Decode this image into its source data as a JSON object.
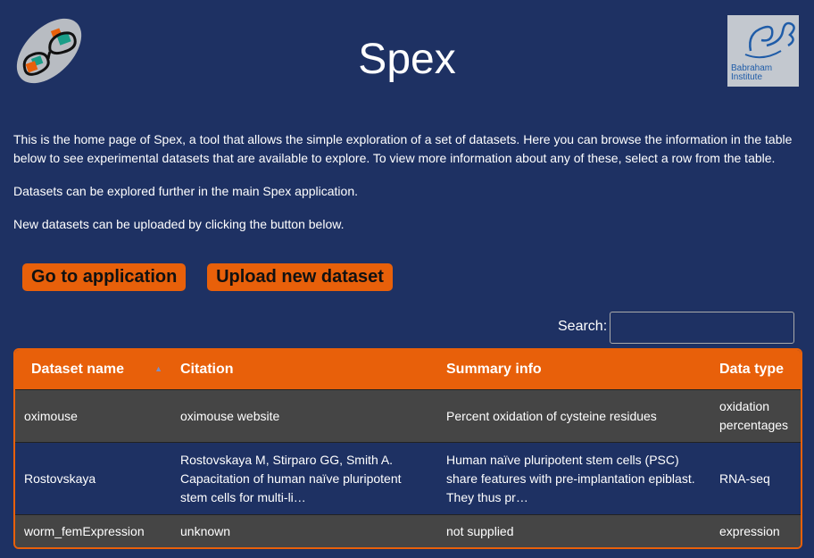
{
  "header": {
    "title": "Spex",
    "institute_logo_text": "Babraham Institute"
  },
  "intro": {
    "paragraphs": [
      "This is the home page of Spex, a tool that allows the simple exploration of a set of datasets. Here you can browse the information in the table below to see experimental datasets that are available to explore. To view more information about any of these, select a row from the table.",
      "Datasets can be explored further in the main Spex application.",
      "New datasets can be uploaded by clicking the button below."
    ]
  },
  "buttons": {
    "go_label": "Go to application",
    "upload_label": "Upload new dataset"
  },
  "search": {
    "label": "Search:",
    "value": ""
  },
  "table": {
    "columns": [
      "Dataset name",
      "Citation",
      "Summary info",
      "Data type"
    ],
    "sort_icon": "sort-ascending-icon",
    "rows": [
      {
        "name": "oximouse",
        "citation": "oximouse website",
        "summary": "Percent oxidation of cysteine residues",
        "type": "oxidation percentages"
      },
      {
        "name": "Rostovskaya",
        "citation": "Rostovskaya M, Stirparo GG, Smith A. Capacitation of human naïve pluripotent stem cells for multi-li…",
        "summary": "Human naïve pluripotent stem cells (PSC) share features with pre-implantation epiblast. They thus pr…",
        "type": "RNA-seq"
      },
      {
        "name": "worm_femExpression",
        "citation": "unknown",
        "summary": "not supplied",
        "type": "expression"
      }
    ]
  },
  "colors": {
    "background": "#1e3163",
    "accent": "#e8600a",
    "row_alt": "#454545"
  }
}
